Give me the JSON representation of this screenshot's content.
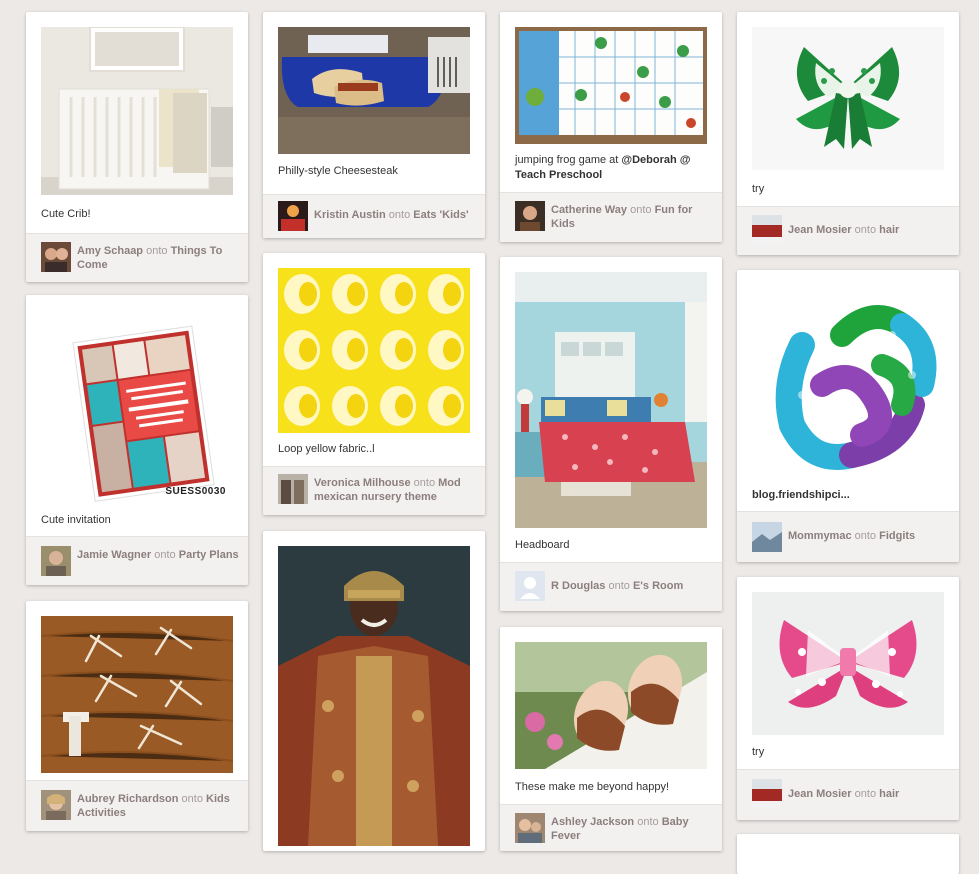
{
  "pins": [
    {
      "description": "Cute Crib!",
      "user": "Amy Schaap",
      "board": "Things To Come"
    },
    {
      "description": "Cute invitation",
      "user": "Jamie Wagner",
      "board": "Party Plans",
      "image_text": "SUESS0030"
    },
    {
      "description": "",
      "user": "Aubrey Richardson",
      "board": "Kids Activities"
    },
    {
      "description": "Philly-style Cheesesteak",
      "user": "Kristin Austin",
      "board": "Eats 'Kids'"
    },
    {
      "description": "Loop yellow fabric..l",
      "user": "Veronica Milhouse",
      "board": "Mod mexican nursery theme"
    },
    {
      "description": "",
      "user": "",
      "board": ""
    },
    {
      "description_plain": "jumping frog game at ",
      "description_bold": "@Deborah @ Teach Preschool",
      "user": "Catherine Way",
      "board": "Fun for Kids"
    },
    {
      "description": "Headboard",
      "user": "R Douglas",
      "board": "E's Room"
    },
    {
      "description": "These make me beyond happy!",
      "user": "Ashley Jackson",
      "board": "Baby Fever"
    },
    {
      "description": "try",
      "user": "Jean Mosier",
      "board": "hair"
    },
    {
      "description": "blog.friendshipci...",
      "user": "Mommymac",
      "board": "Fidgits"
    },
    {
      "description": "try",
      "user": "Jean Mosier",
      "board": "hair"
    }
  ],
  "onto": "onto",
  "colors": {
    "background": "#ece9e7",
    "attribution_bg": "#f3f1f0",
    "user_text": "#8c7e7e"
  }
}
